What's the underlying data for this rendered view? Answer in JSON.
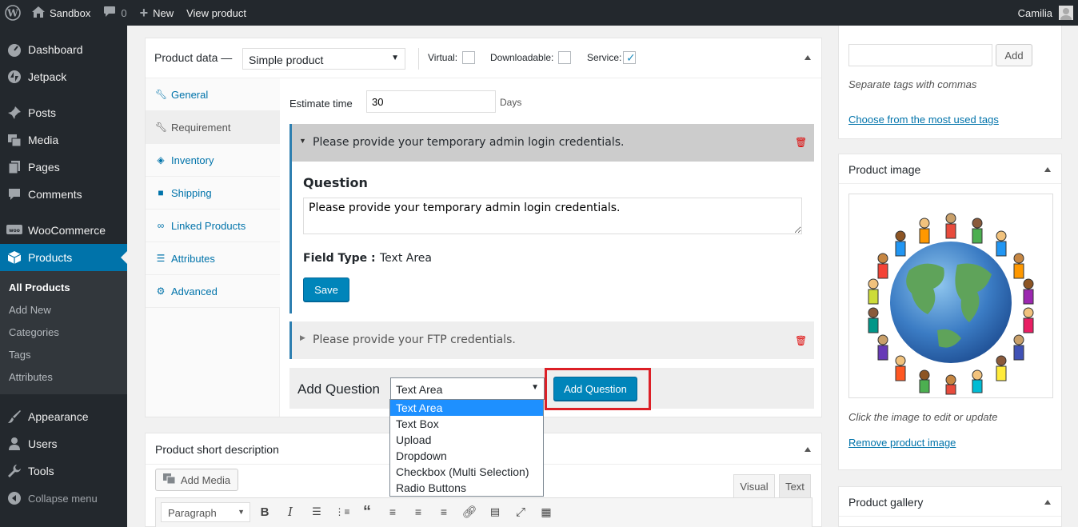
{
  "adminbar": {
    "site_name": "Sandbox",
    "comments_count": "0",
    "new_label": "New",
    "view_product": "View product",
    "user_name": "Camilia"
  },
  "sidebar": {
    "items": [
      {
        "label": "Dashboard",
        "icon": "dashboard-icon"
      },
      {
        "label": "Jetpack",
        "icon": "jetpack-icon"
      },
      {
        "label": "Posts",
        "icon": "pin-icon"
      },
      {
        "label": "Media",
        "icon": "media-icon"
      },
      {
        "label": "Pages",
        "icon": "pages-icon"
      },
      {
        "label": "Comments",
        "icon": "comment-icon"
      },
      {
        "label": "WooCommerce",
        "icon": "woo-icon"
      },
      {
        "label": "Products",
        "icon": "box-icon"
      },
      {
        "label": "Appearance",
        "icon": "brush-icon"
      },
      {
        "label": "Users",
        "icon": "user-icon"
      },
      {
        "label": "Tools",
        "icon": "wrench-icon"
      },
      {
        "label": "Collapse menu",
        "icon": "collapse-icon"
      }
    ],
    "submenu": [
      "All Products",
      "Add New",
      "Categories",
      "Tags",
      "Attributes"
    ]
  },
  "product_data": {
    "title": "Product data —",
    "type_select": "Simple product",
    "virtual_label": "Virtual:",
    "downloadable_label": "Downloadable:",
    "service_label": "Service:",
    "service_checked": true,
    "tabs": [
      "General",
      "Requirement",
      "Inventory",
      "Shipping",
      "Linked Products",
      "Attributes",
      "Advanced"
    ],
    "estimate_label": "Estimate time",
    "estimate_value": "30",
    "estimate_unit": "Days",
    "q1_header": "Please provide your temporary admin login credentials.",
    "question_label": "Question",
    "question_value": "Please provide your temporary admin login credentials.",
    "field_type_label": "Field Type :",
    "field_type_value": "Text Area",
    "save_label": "Save",
    "q2_header": "Please provide your FTP credentials.",
    "add_question_label": "Add Question",
    "add_question_select": "Text Area",
    "add_question_button": "Add Question",
    "dropdown_options": [
      "Text Area",
      "Text Box",
      "Upload",
      "Dropdown",
      "Checkbox (Multi Selection)",
      "Radio Buttons"
    ]
  },
  "short_desc": {
    "title": "Product short description",
    "add_media": "Add Media",
    "tab_visual": "Visual",
    "tab_text": "Text",
    "format_select": "Paragraph"
  },
  "tags_box": {
    "add_button": "Add",
    "hint": "Separate tags with commas",
    "choose_link": "Choose from the most used tags"
  },
  "product_image": {
    "title": "Product image",
    "hint": "Click the image to edit or update",
    "remove_link": "Remove product image"
  },
  "product_gallery": {
    "title": "Product gallery"
  },
  "colors": {
    "accent": "#0073aa",
    "highlight_box": "#dc1f26",
    "button_primary": "#0085ba"
  }
}
